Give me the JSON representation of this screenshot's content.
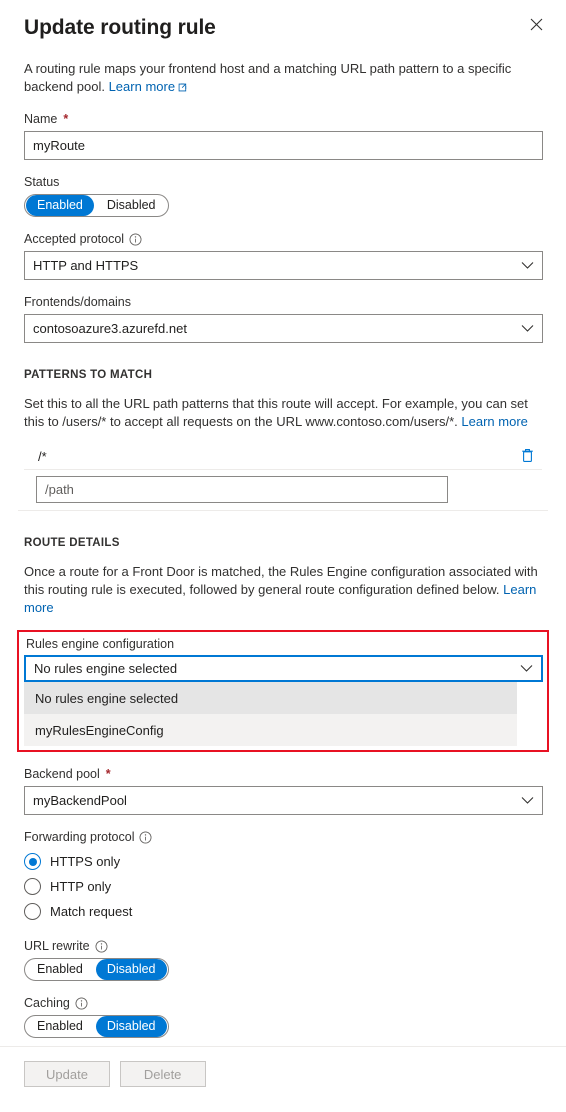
{
  "header": {
    "title": "Update routing rule",
    "close_icon": "close-icon"
  },
  "intro": {
    "text": "A routing rule maps your frontend host and a matching URL path pattern to a specific backend pool.",
    "link": "Learn more",
    "link_icon": "external-link-icon"
  },
  "name": {
    "label": "Name",
    "required_marker": "*",
    "value": "myRoute"
  },
  "status": {
    "label": "Status",
    "options": [
      "Enabled",
      "Disabled"
    ],
    "selected": "Enabled"
  },
  "accepted_protocol": {
    "label": "Accepted protocol",
    "info_icon": "info-icon",
    "value": "HTTP and HTTPS",
    "chevron_icon": "chevron-down-icon"
  },
  "frontends": {
    "label": "Frontends/domains",
    "value": "contosoazure3.azurefd.net",
    "chevron_icon": "chevron-down-icon"
  },
  "patterns": {
    "section_title": "PATTERNS TO MATCH",
    "description": "Set this to all the URL path patterns that this route will accept. For example, you can set this to /users/* to accept all requests on the URL www.contoso.com/users/*.",
    "link": "Learn more",
    "rows": [
      {
        "value": "/*",
        "delete_icon": "trash-icon"
      }
    ],
    "new_pattern_placeholder": "/path",
    "new_pattern_value": ""
  },
  "route_details": {
    "section_title": "ROUTE DETAILS",
    "description": "Once a route for a Front Door is matched, the Rules Engine configuration associated with this routing rule is executed, followed by general route configuration defined below.",
    "link": "Learn more"
  },
  "rules_engine": {
    "label": "Rules engine configuration",
    "selected": "No rules engine selected",
    "chevron_icon": "chevron-down-icon",
    "options": [
      "No rules engine selected",
      "myRulesEngineConfig"
    ],
    "highlight_color": "#e81123",
    "focus_color": "#0078d4"
  },
  "backend_pool": {
    "label": "Backend pool",
    "required_marker": "*",
    "value": "myBackendPool",
    "chevron_icon": "chevron-down-icon"
  },
  "forwarding_protocol": {
    "label": "Forwarding protocol",
    "info_icon": "info-icon",
    "options": [
      "HTTPS only",
      "HTTP only",
      "Match request"
    ],
    "selected": "HTTPS only"
  },
  "url_rewrite": {
    "label": "URL rewrite",
    "info_icon": "info-icon",
    "options": [
      "Enabled",
      "Disabled"
    ],
    "selected": "Disabled"
  },
  "caching": {
    "label": "Caching",
    "info_icon": "info-icon",
    "options": [
      "Enabled",
      "Disabled"
    ],
    "selected": "Disabled"
  },
  "footer": {
    "update_label": "Update",
    "delete_label": "Delete"
  },
  "colors": {
    "accent": "#0078d4",
    "link": "#0063b1",
    "required": "#a4262c",
    "highlight": "#e81123"
  }
}
